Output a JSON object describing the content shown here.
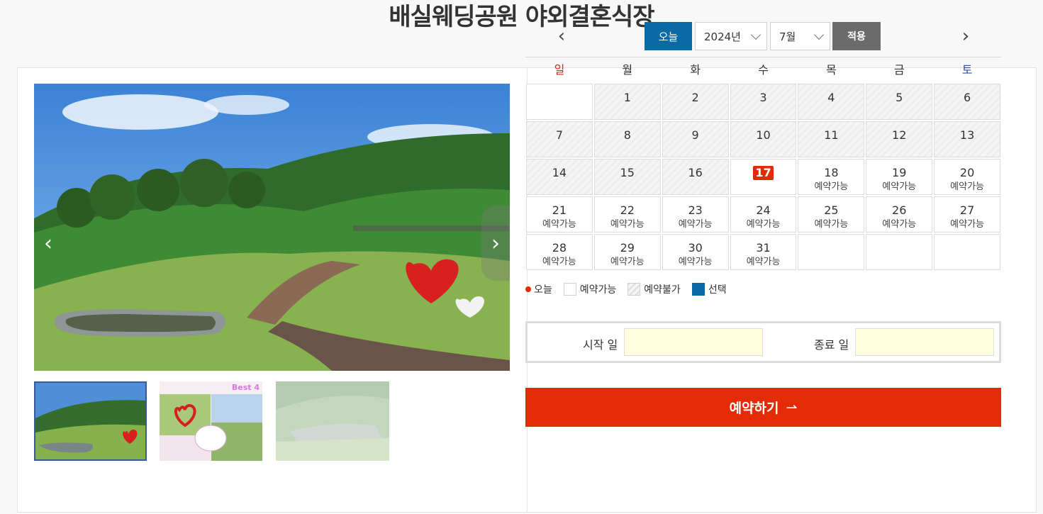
{
  "page": {
    "title": "배실웨딩공원 야외결혼식장"
  },
  "gallery": {
    "prev_glyph": "‹",
    "next_glyph": "›",
    "thumbs": [
      {
        "name": "thumb-1",
        "selected": true
      },
      {
        "name": "thumb-2",
        "label": "Best 4"
      },
      {
        "name": "thumb-3"
      }
    ]
  },
  "calendar": {
    "prev_glyph": "‹",
    "next_glyph": "›",
    "today_label": "오늘",
    "year_value": "2024년",
    "month_value": "7월",
    "apply_label": "적용",
    "weekdays": [
      "일",
      "월",
      "화",
      "수",
      "목",
      "금",
      "토"
    ],
    "weeks": [
      [
        {
          "d": ""
        },
        {
          "d": "1",
          "s": "closed"
        },
        {
          "d": "2",
          "s": "closed"
        },
        {
          "d": "3",
          "s": "closed"
        },
        {
          "d": "4",
          "s": "closed"
        },
        {
          "d": "5",
          "s": "closed"
        },
        {
          "d": "6",
          "s": "closed"
        }
      ],
      [
        {
          "d": "7",
          "s": "closed"
        },
        {
          "d": "8",
          "s": "closed"
        },
        {
          "d": "9",
          "s": "closed"
        },
        {
          "d": "10",
          "s": "closed"
        },
        {
          "d": "11",
          "s": "closed"
        },
        {
          "d": "12",
          "s": "closed"
        },
        {
          "d": "13",
          "s": "closed"
        }
      ],
      [
        {
          "d": "14",
          "s": "closed"
        },
        {
          "d": "15",
          "s": "closed"
        },
        {
          "d": "16",
          "s": "closed"
        },
        {
          "d": "17",
          "s": "today"
        },
        {
          "d": "18",
          "s": "available",
          "t": "예약가능"
        },
        {
          "d": "19",
          "s": "available",
          "t": "예약가능"
        },
        {
          "d": "20",
          "s": "available",
          "t": "예약가능"
        }
      ],
      [
        {
          "d": "21",
          "s": "available",
          "t": "예약가능"
        },
        {
          "d": "22",
          "s": "available",
          "t": "예약가능"
        },
        {
          "d": "23",
          "s": "available",
          "t": "예약가능"
        },
        {
          "d": "24",
          "s": "available",
          "t": "예약가능"
        },
        {
          "d": "25",
          "s": "available",
          "t": "예약가능"
        },
        {
          "d": "26",
          "s": "available",
          "t": "예약가능"
        },
        {
          "d": "27",
          "s": "available",
          "t": "예약가능"
        }
      ],
      [
        {
          "d": "28",
          "s": "available",
          "t": "예약가능"
        },
        {
          "d": "29",
          "s": "available",
          "t": "예약가능"
        },
        {
          "d": "30",
          "s": "available",
          "t": "예약가능"
        },
        {
          "d": "31",
          "s": "available",
          "t": "예약가능"
        },
        {
          "d": ""
        },
        {
          "d": ""
        },
        {
          "d": ""
        }
      ]
    ],
    "legend": {
      "today": "오늘",
      "available": "예약가능",
      "unavailable": "예약불가",
      "selected": "선택"
    }
  },
  "booking": {
    "start_label": "시작 일",
    "start_value": "",
    "end_label": "종료 일",
    "end_value": "",
    "submit_label": "예약하기",
    "submit_arrow": "⇀"
  },
  "colors": {
    "accent_blue": "#0a6aa6",
    "accent_red": "#e42b07",
    "apply_gray": "#6b6b6b",
    "input_bg": "#ffffe0"
  }
}
